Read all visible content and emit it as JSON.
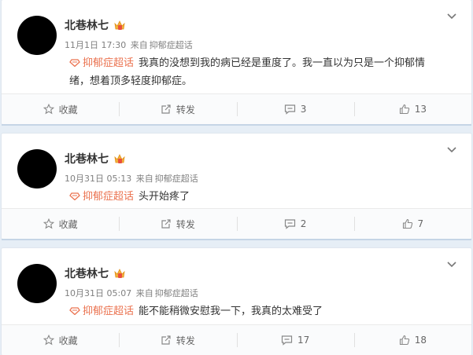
{
  "posts": [
    {
      "username": "北巷林七",
      "time": "11月1日 17:30",
      "source_prefix": "来自",
      "source": "抑郁症超话",
      "topic": "抑郁症超话",
      "text": "我真的没想到我的病已经是重度了。我一直以为只是一个抑郁情绪，想着顶多轻度抑郁症。",
      "actions": {
        "favorite": "收藏",
        "repost": "转发",
        "comments": "3",
        "likes": "13"
      }
    },
    {
      "username": "北巷林七",
      "time": "10月31日 05:13",
      "source_prefix": "来自",
      "source": "抑郁症超话",
      "topic": "抑郁症超话",
      "text": "头开始疼了",
      "actions": {
        "favorite": "收藏",
        "repost": "转发",
        "comments": "2",
        "likes": "7"
      }
    },
    {
      "username": "北巷林七",
      "time": "10月31日 05:07",
      "source_prefix": "来自",
      "source": "抑郁症超话",
      "topic": "抑郁症超话",
      "text": "能不能稍微安慰我一下，我真的太难受了",
      "actions": {
        "favorite": "收藏",
        "repost": "转发",
        "comments": "17",
        "likes": "18"
      }
    }
  ],
  "icons": {
    "badge": "vip-crown-icon",
    "menu": "chevron-down-icon",
    "topic": "super-topic-diamond-icon",
    "favorite": "star-icon",
    "repost": "repost-icon",
    "comment": "comment-icon",
    "like": "thumbs-up-icon"
  },
  "colors": {
    "topic": "#eb7350",
    "page_bg": "#e6eef6"
  }
}
